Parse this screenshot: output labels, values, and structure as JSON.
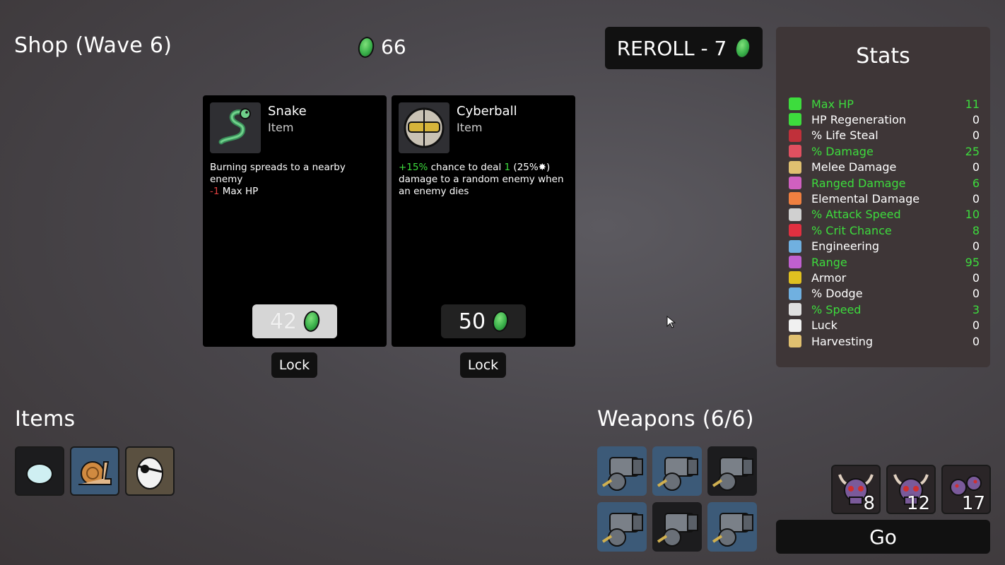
{
  "header": {
    "shop_title": "Shop (Wave 6)",
    "money": "66",
    "reroll_label": "REROLL - 7"
  },
  "stats": {
    "title": "Stats",
    "rows": [
      {
        "label": "Max HP",
        "value": "11",
        "highlight": true,
        "icon": "heart-icon",
        "color": "#3ddc3d"
      },
      {
        "label": "HP Regeneration",
        "value": "0",
        "highlight": false,
        "icon": "heart-plus-icon",
        "color": "#3ddc3d"
      },
      {
        "label": "% Life Steal",
        "value": "0",
        "highlight": false,
        "icon": "fangs-icon",
        "color": "#c0303a"
      },
      {
        "label": "% Damage",
        "value": "25",
        "highlight": true,
        "icon": "fist-icon",
        "color": "#e05060"
      },
      {
        "label": "Melee Damage",
        "value": "0",
        "highlight": false,
        "icon": "sword-icon",
        "color": "#e0c070"
      },
      {
        "label": "Ranged Damage",
        "value": "6",
        "highlight": true,
        "icon": "bow-icon",
        "color": "#d060c0"
      },
      {
        "label": "Elemental Damage",
        "value": "0",
        "highlight": false,
        "icon": "flame-icon",
        "color": "#f08040"
      },
      {
        "label": "% Attack Speed",
        "value": "10",
        "highlight": true,
        "icon": "hourglass-icon",
        "color": "#d0d0d0"
      },
      {
        "label": "% Crit Chance",
        "value": "8",
        "highlight": true,
        "icon": "crit-icon",
        "color": "#e03040"
      },
      {
        "label": "Engineering",
        "value": "0",
        "highlight": false,
        "icon": "wrench-icon",
        "color": "#70b0e0"
      },
      {
        "label": "Range",
        "value": "95",
        "highlight": true,
        "icon": "signal-icon",
        "color": "#c060d0"
      },
      {
        "label": "Armor",
        "value": "0",
        "highlight": false,
        "icon": "shield-icon",
        "color": "#e0c020"
      },
      {
        "label": "% Dodge",
        "value": "0",
        "highlight": false,
        "icon": "wind-icon",
        "color": "#70b0e0"
      },
      {
        "label": "% Speed",
        "value": "3",
        "highlight": true,
        "icon": "boot-icon",
        "color": "#e0e0e0"
      },
      {
        "label": "Luck",
        "value": "0",
        "highlight": false,
        "icon": "dice-icon",
        "color": "#f0f0f0"
      },
      {
        "label": "Harvesting",
        "value": "0",
        "highlight": false,
        "icon": "wheat-icon",
        "color": "#e0c070"
      }
    ]
  },
  "cards": [
    {
      "name": "Snake",
      "type": "Item",
      "desc_line1": "Burning spreads to a nearby enemy",
      "mod_value": "-1",
      "mod_label": " Max HP",
      "price": "42",
      "lock_label": "Lock"
    },
    {
      "name": "Cyberball",
      "type": "Item",
      "desc_a": "+15%",
      "desc_b": " chance to deal ",
      "desc_c": "1",
      "desc_d": " (25%",
      "desc_e": ") damage to a random enemy when an enemy dies",
      "price": "50",
      "lock_label": "Lock"
    }
  ],
  "items": {
    "title": "Items",
    "list": [
      {
        "icon": "egg-blob-icon"
      },
      {
        "icon": "snail-icon"
      },
      {
        "icon": "eyepatch-egg-icon"
      }
    ]
  },
  "weapons": {
    "title": "Weapons (6/6)",
    "icon": "minigun-icon"
  },
  "enemies": [
    {
      "icon": "horned-skull-icon",
      "count": "8"
    },
    {
      "icon": "horned-skull-icon",
      "count": "12"
    },
    {
      "icon": "blob-swarm-icon",
      "count": "17"
    }
  ],
  "go_label": "Go"
}
